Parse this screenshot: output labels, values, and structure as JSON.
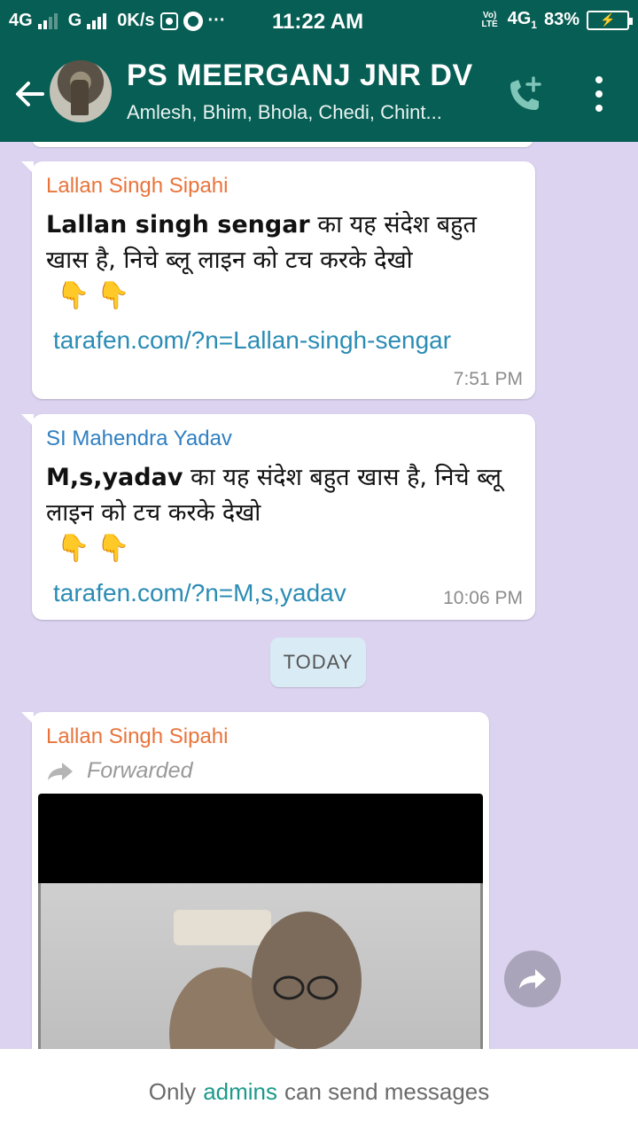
{
  "status_bar": {
    "network1": "4G",
    "network2": "G",
    "speed": "0K/s",
    "dots": "···",
    "time": "11:22 AM",
    "volte": "Vo) LTE",
    "network3": "4G",
    "sim_index": "1",
    "battery_percent": "83%",
    "battery_level": 0.83
  },
  "header": {
    "title": "PS MEERGANJ JNR DV",
    "subtitle": "Amlesh, Bhim, Bhola, Chedi, Chint..."
  },
  "messages": [
    {
      "sender": "Lallan Singh Sipahi",
      "sender_color": "#e8743b",
      "bold": "Lallan singh sengar",
      "text": " का यह संदेश बहुत खास है, निचे ब्लू लाइन को टच करके देखो",
      "emoji": "👇👇",
      "link": "tarafen.com/?n=Lallan-singh-sengar",
      "time": "7:51 PM"
    },
    {
      "sender": "SI Mahendra Yadav",
      "sender_color": "#2f7fc1",
      "bold": "M,s,yadav",
      "text": " का यह संदेश बहुत खास है, निचे ब्लू लाइन को टच करके देखो",
      "emoji": "👇👇",
      "link": "tarafen.com/?n=M,s,yadav",
      "time": "10:06 PM"
    },
    {
      "sender": "Lallan Singh Sipahi",
      "sender_color": "#e8743b",
      "forwarded_label": "Forwarded"
    }
  ],
  "date_divider": "TODAY",
  "footer": {
    "prefix": "Only",
    "link": "admins",
    "suffix": "can send messages"
  }
}
